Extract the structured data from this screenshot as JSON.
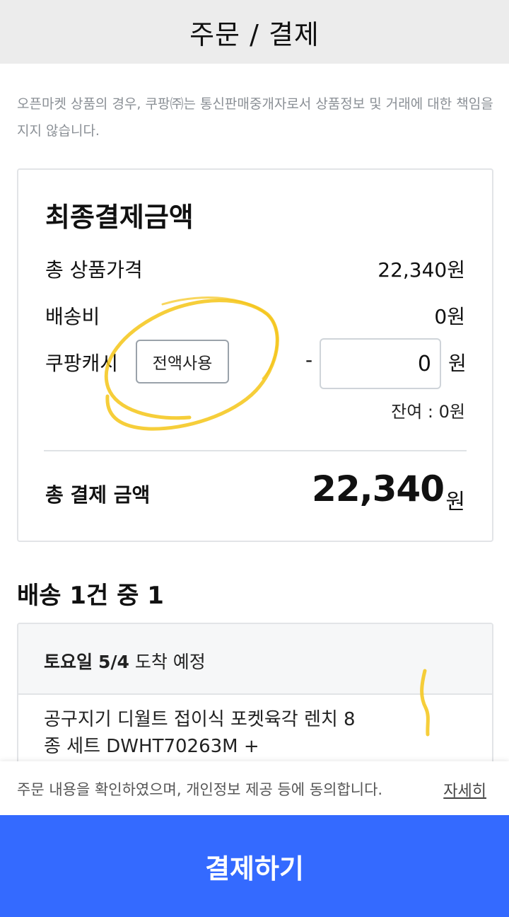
{
  "header": {
    "title": "주문 / 결제"
  },
  "notice": "오픈마켓 상품의 경우, 쿠팡㈜는 통신판매중개자로서 상품정보 및 거래에 대한 책임을 지지 않습니다.",
  "summary": {
    "title": "최종결제금액",
    "product_price_label": "총 상품가격",
    "product_price_value": "22,340원",
    "shipping_label": "배송비",
    "shipping_value": "0원",
    "cash_label": "쿠팡캐시",
    "use_all_button": "전액사용",
    "cash_minus": "-",
    "cash_input_value": "0",
    "cash_unit": "원",
    "remaining": "잔여 : 0원",
    "total_label": "총 결제 금액",
    "total_amount": "22,340",
    "total_unit": "원"
  },
  "shipping": {
    "heading": "배송 1건 중 1",
    "arrival_day": "토요일",
    "arrival_date": "5/4",
    "arrival_suffix": "도착 예정",
    "product_name": "공구지기 디월트 접이식 포켓육각 렌치 8종 세트 DWHT70263M +"
  },
  "footer": {
    "consent": "주문 내용을 확인하였으며, 개인정보 제공 등에 동의합니다.",
    "detail_link": "자세히",
    "pay_button": "결제하기"
  },
  "colors": {
    "primary": "#346aff",
    "header_bg": "#ececec",
    "annotation": "#f5c518"
  }
}
